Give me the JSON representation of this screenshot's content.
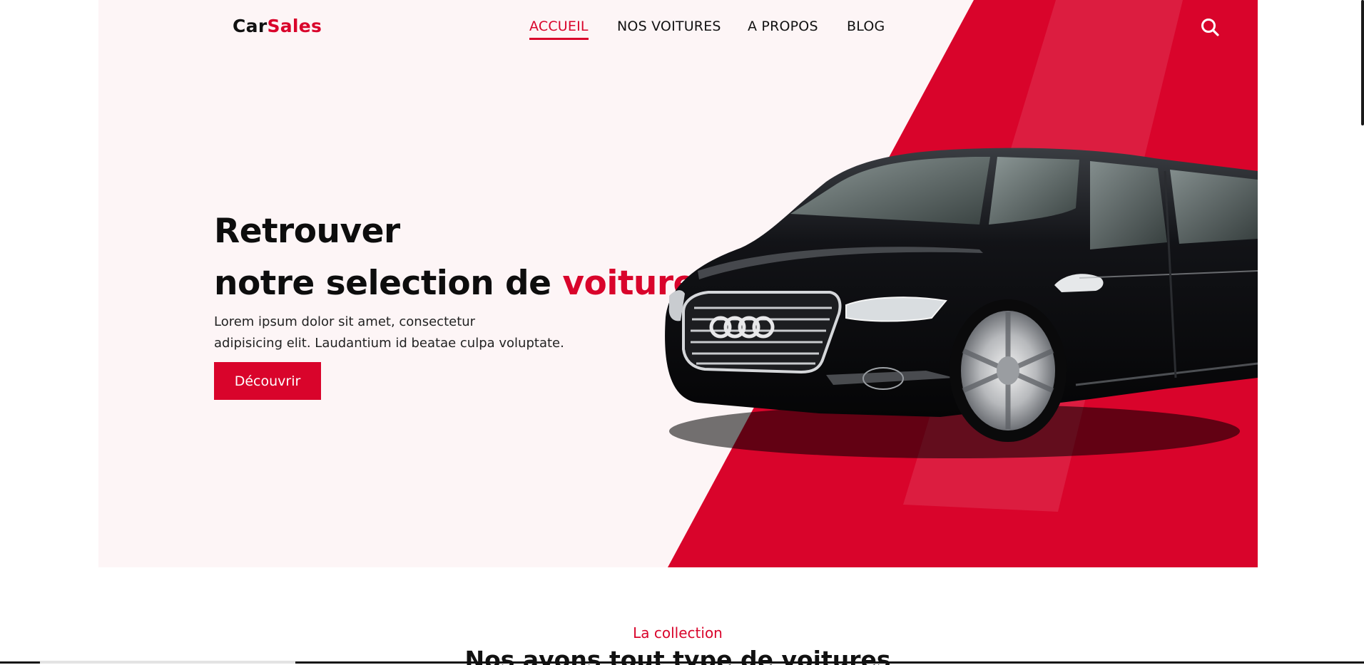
{
  "header": {
    "logo": {
      "part1": "Car",
      "part2": "Sales"
    },
    "nav": [
      {
        "label": "ACCUEIL",
        "active": true
      },
      {
        "label": "NOS VOITURES",
        "active": false
      },
      {
        "label": "A PROPOS",
        "active": false
      },
      {
        "label": "BLOG",
        "active": false
      }
    ],
    "search_icon": "search-icon"
  },
  "hero": {
    "title_line1": "Retrouver",
    "title_line2": "notre selection de ",
    "title_accent": "voitures",
    "description_line1": "Lorem ipsum dolor sit amet, consectetur",
    "description_line2": "adipisicing elit. Laudantium id beatae culpa voluptate.",
    "cta_label": "Découvrir",
    "image": "black-sedan-car"
  },
  "collection": {
    "eyebrow": "La collection",
    "title": "Nos avons tout type de voitures"
  },
  "colors": {
    "accent": "#d9042b",
    "hero_bg": "#fdf5f6",
    "text": "#111111"
  }
}
